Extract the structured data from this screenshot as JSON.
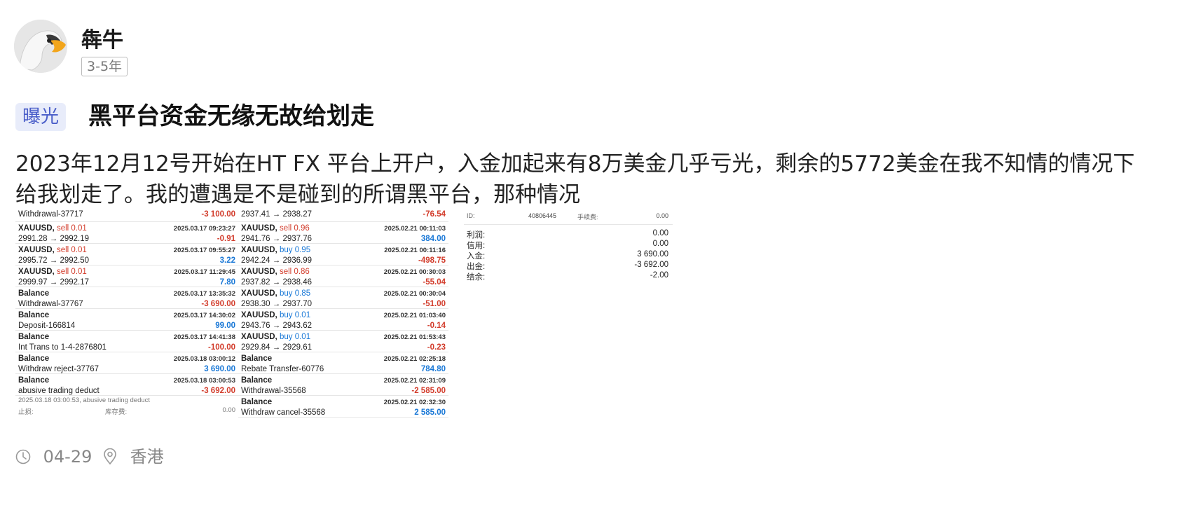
{
  "author": {
    "name": "犇牛",
    "badge": "3-5年"
  },
  "post": {
    "tag": "曝光",
    "title": "黑平台资金无缘无故给划走",
    "content": "2023年12月12号开始在HT FX 平台上开户，入金加起来有8万美金几乎亏光，剩余的5772美金在我不知情的情况下给我划走了。我的遭遇是不是碰到的所谓黑平台，那种情况"
  },
  "screenshot1": {
    "top_partial": {
      "label": "Withdrawal-37717",
      "value": "-3 100.00"
    },
    "records": [
      {
        "title": "XAUUSD,",
        "action": "sell 0.01",
        "time": "2025.03.17 09:23:27",
        "detail": "2991.28 → 2992.19",
        "value": "-0.91",
        "sign": "neg"
      },
      {
        "title": "XAUUSD,",
        "action": "sell 0.01",
        "time": "2025.03.17 09:55:27",
        "detail": "2995.72 → 2992.50",
        "value": "3.22",
        "sign": "pos"
      },
      {
        "title": "XAUUSD,",
        "action": "sell 0.01",
        "time": "2025.03.17 11:29:45",
        "detail": "2999.97 → 2992.17",
        "value": "7.80",
        "sign": "pos"
      },
      {
        "title": "Balance",
        "action": "",
        "time": "2025.03.17 13:35:32",
        "detail": "Withdrawal-37767",
        "value": "-3 690.00",
        "sign": "neg"
      },
      {
        "title": "Balance",
        "action": "",
        "time": "2025.03.17 14:30:02",
        "detail": "Deposit-166814",
        "value": "99.00",
        "sign": "pos"
      },
      {
        "title": "Balance",
        "action": "",
        "time": "2025.03.17 14:41:38",
        "detail": "Int Trans to 1-4-2876801",
        "value": "-100.00",
        "sign": "neg"
      },
      {
        "title": "Balance",
        "action": "",
        "time": "2025.03.18 03:00:12",
        "detail": "Withdraw reject-37767",
        "value": "3 690.00",
        "sign": "pos"
      },
      {
        "title": "Balance",
        "action": "",
        "time": "2025.03.18 03:00:53",
        "detail": "abusive trading deduct",
        "value": "-3 692.00",
        "sign": "neg"
      }
    ],
    "tooltip": "2025.03.18 03:00:53, abusive trading deduct",
    "footer_left": "止损:",
    "footer_mid": "库存费:",
    "footer_right": "0.00"
  },
  "screenshot2": {
    "top_partial": {
      "detail": "2937.41 → 2938.27",
      "value": "-76.54"
    },
    "records": [
      {
        "title": "XAUUSD,",
        "action": "sell 0.96",
        "action_type": "sell",
        "time": "2025.02.21 00:11:03",
        "detail": "2941.76 → 2937.76",
        "value": "384.00",
        "sign": "pos"
      },
      {
        "title": "XAUUSD,",
        "action": "buy 0.95",
        "action_type": "buy",
        "time": "2025.02.21 00:11:16",
        "detail": "2942.24 → 2936.99",
        "value": "-498.75",
        "sign": "neg"
      },
      {
        "title": "XAUUSD,",
        "action": "sell 0.86",
        "action_type": "sell",
        "time": "2025.02.21 00:30:03",
        "detail": "2937.82 → 2938.46",
        "value": "-55.04",
        "sign": "neg"
      },
      {
        "title": "XAUUSD,",
        "action": "buy 0.85",
        "action_type": "buy",
        "time": "2025.02.21 00:30:04",
        "detail": "2938.30 → 2937.70",
        "value": "-51.00",
        "sign": "neg"
      },
      {
        "title": "XAUUSD,",
        "action": "buy 0.01",
        "action_type": "buy",
        "time": "2025.02.21 01:03:40",
        "detail": "2943.76 → 2943.62",
        "value": "-0.14",
        "sign": "neg"
      },
      {
        "title": "XAUUSD,",
        "action": "buy 0.01",
        "action_type": "buy",
        "time": "2025.02.21 01:53:43",
        "detail": "2929.84 → 2929.61",
        "value": "-0.23",
        "sign": "neg"
      },
      {
        "title": "Balance",
        "action": "",
        "action_type": "",
        "time": "2025.02.21 02:25:18",
        "detail": "Rebate Transfer-60776",
        "value": "784.80",
        "sign": "pos"
      },
      {
        "title": "Balance",
        "action": "",
        "action_type": "",
        "time": "2025.02.21 02:31:09",
        "detail": "Withdrawal-35568",
        "value": "-2 585.00",
        "sign": "neg"
      },
      {
        "title": "Balance",
        "action": "",
        "action_type": "",
        "time": "2025.02.21 02:32:30",
        "detail": "Withdraw cancel-35568",
        "value": "2 585.00",
        "sign": "pos"
      }
    ]
  },
  "screenshot3": {
    "header_id_label": "ID:",
    "header_id": "40806445",
    "header_fee_label": "手续费:",
    "header_fee": "0.00",
    "rows": [
      {
        "label": "利润:",
        "value": "0.00"
      },
      {
        "label": "信用:",
        "value": "0.00"
      },
      {
        "label": "入金:",
        "value": "3 690.00"
      },
      {
        "label": "出金:",
        "value": "-3 692.00"
      },
      {
        "label": "结余:",
        "value": "-2.00"
      }
    ]
  },
  "meta": {
    "date": "04-29",
    "location": "香港"
  }
}
